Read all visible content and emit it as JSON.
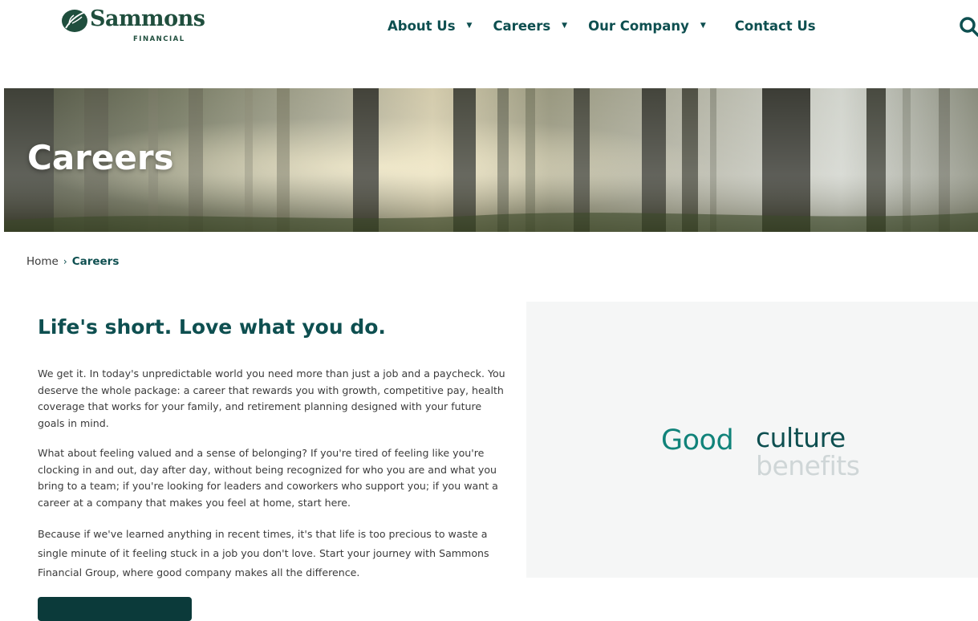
{
  "brand": {
    "name": "Sammons",
    "subtitle": "FINANCIAL",
    "color": "#1f4e3d"
  },
  "nav": {
    "items": [
      {
        "label": "About Us",
        "has_caret": true
      },
      {
        "label": "Careers",
        "has_caret": true
      },
      {
        "label": "Our Company",
        "has_caret": true
      },
      {
        "label": "Contact Us",
        "has_caret": false
      }
    ],
    "search_icon": "search-icon",
    "accent": "#0e4f50"
  },
  "hero": {
    "title": "Careers"
  },
  "breadcrumb": {
    "home": "Home",
    "separator": "›",
    "current": "Careers"
  },
  "main": {
    "heading": "Life's short. Love what you do.",
    "paragraphs": [
      "We get it. In today's unpredictable world you need more than just a job and a paycheck. You deserve the whole package: a career that rewards you with growth, competitive pay, health coverage that works for your family, and retirement planning designed with your future goals in mind.",
      "What about feeling valued and a sense of belonging? If you're tired of feeling like you're clocking in and out, day after day, without being recognized for who you are and what you bring to a team; if you're looking for leaders and coworkers who support you; if you want a career at a company that makes you feel at home, start here.",
      "Because if we've learned anything in recent times, it's that life is too precious to waste a single minute of it feeling stuck in a job you don't love. Start your journey with Sammons Financial Group, where good company makes all the difference."
    ],
    "cta_color": "#0b3a3a"
  },
  "panel": {
    "word_good": "Good",
    "word_culture": "culture",
    "word_benefits": "benefits",
    "colors": {
      "good": "#11837a",
      "culture": "#0e4f50",
      "benefits": "#cfd6d7"
    }
  }
}
